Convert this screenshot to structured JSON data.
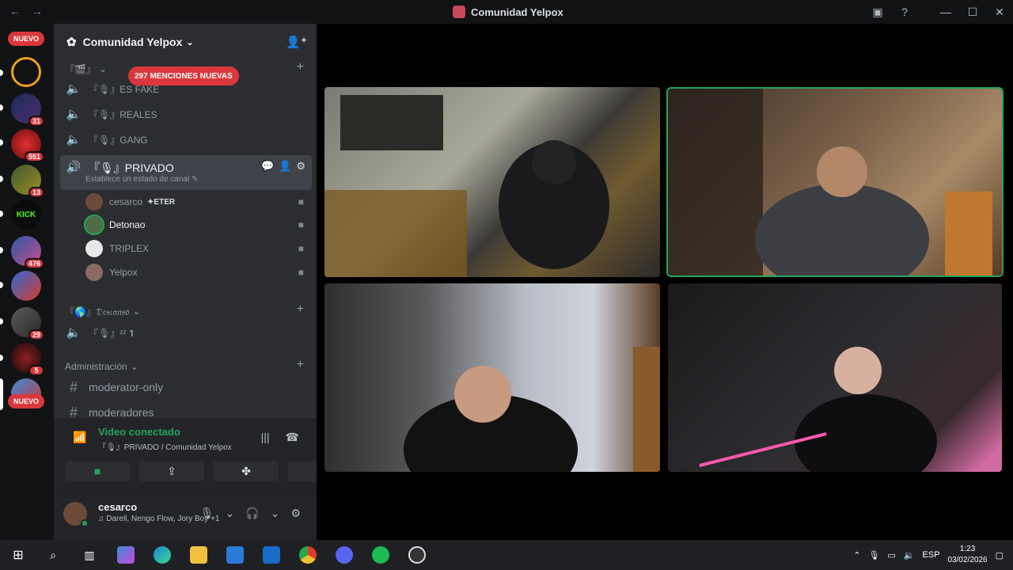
{
  "window": {
    "title": "Comunidad Yelpox",
    "nav_back": "←",
    "nav_forward": "→",
    "inbox_icon": "▣",
    "help_icon": "?",
    "minimize": "—",
    "maximize": "☐",
    "close": "✕"
  },
  "guilds": {
    "top_badge": "NUEVO",
    "bottom_badge": "NUEVO",
    "kick_label": "KICK",
    "items": [
      {
        "name": "server-c",
        "badge": ""
      },
      {
        "name": "server-hero",
        "badge": "31"
      },
      {
        "name": "server-red",
        "badge": "551"
      },
      {
        "name": "server-green",
        "badge": "13"
      },
      {
        "name": "server-kick",
        "badge": ""
      },
      {
        "name": "server-anime",
        "badge": "476"
      },
      {
        "name": "server-blue",
        "badge": ""
      },
      {
        "name": "server-gray",
        "badge": "29"
      },
      {
        "name": "server-dark",
        "badge": "5"
      },
      {
        "name": "server-avatar",
        "badge": ""
      }
    ]
  },
  "server": {
    "name": "Comunidad Yelpox",
    "mentions_pill": "297 MENCIONES NUEVAS",
    "top_category": "『🎬』",
    "voice_channels": [
      {
        "name": "『🎙』ES FAKE"
      },
      {
        "name": "『🎙』REALES"
      },
      {
        "name": "『🎙』GANG"
      }
    ],
    "active_channel": {
      "name": "『🎙』PRIVADO",
      "status": "Establece un estado de canal ✎"
    },
    "members": [
      {
        "name": "cesarco",
        "tag": "✦ETER",
        "color": "#6b4a3a"
      },
      {
        "name": "Detonao",
        "tag": "",
        "color": "#4f6b45"
      },
      {
        "name": "TRIPLEX",
        "tag": "",
        "color": "#e8e8e8"
      },
      {
        "name": "Yelpox",
        "tag": "",
        "color": "#8a6a62"
      }
    ],
    "descanso_category": "『🌎』𝔇𝔢𝔰𝔠𝔞𝔫𝔰𝔬",
    "descanso_channel": "『🎙』ᶻᶻ 𝟏",
    "admin_category": "Administración",
    "text_channels": [
      "moderator-only",
      "moderadores"
    ]
  },
  "voice": {
    "status": "Video conectado",
    "location": "『🎙』PRIVADO / Comunidad Yelpox"
  },
  "user": {
    "name": "cesarco",
    "activity": "♫ Darell, Nengo Flow, Jory Boy +1"
  },
  "taskbar": {
    "language": "ESP",
    "time": "1:23",
    "date": "03/02/2026"
  },
  "colors": {
    "accent_green": "#23a55a",
    "danger_red": "#da373c",
    "sidebar_bg": "#2b2d31",
    "guild_bg": "#111214"
  }
}
